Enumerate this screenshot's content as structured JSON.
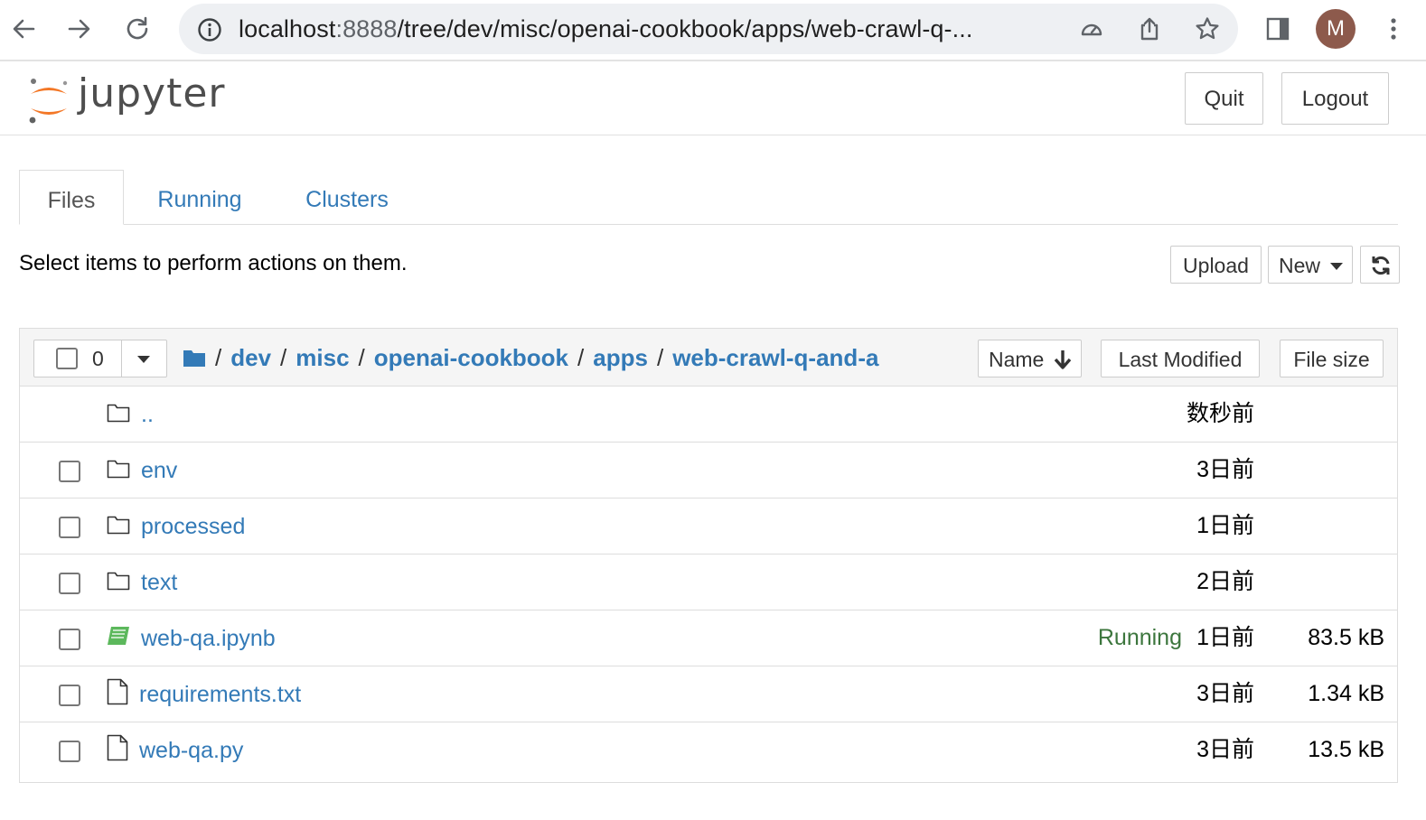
{
  "browser": {
    "url_host": "localhost",
    "url_port": ":8888",
    "url_path": "/tree/dev/misc/openai-cookbook/apps/web-crawl-q-...",
    "avatar_letter": "M"
  },
  "header": {
    "logo_text": "jupyter",
    "quit_label": "Quit",
    "logout_label": "Logout"
  },
  "tabs": [
    {
      "label": "Files"
    },
    {
      "label": "Running"
    },
    {
      "label": "Clusters"
    }
  ],
  "toolbar": {
    "hint": "Select items to perform actions on them.",
    "upload_label": "Upload",
    "new_label": "New"
  },
  "list": {
    "selected_count": "0",
    "breadcrumbs": [
      "dev",
      "misc",
      "openai-cookbook",
      "apps",
      "web-crawl-q-and-a"
    ],
    "sort_name_label": "Name",
    "sort_modified_label": "Last Modified",
    "sort_size_label": "File size",
    "rows": [
      {
        "name": "..",
        "type": "folder",
        "status": "",
        "modified": "数秒前",
        "size": ""
      },
      {
        "name": "env",
        "type": "folder",
        "status": "",
        "modified": "3日前",
        "size": ""
      },
      {
        "name": "processed",
        "type": "folder",
        "status": "",
        "modified": "1日前",
        "size": ""
      },
      {
        "name": "text",
        "type": "folder",
        "status": "",
        "modified": "2日前",
        "size": ""
      },
      {
        "name": "web-qa.ipynb",
        "type": "notebook",
        "status": "Running",
        "modified": "1日前",
        "size": "83.5 kB"
      },
      {
        "name": "requirements.txt",
        "type": "file",
        "status": "",
        "modified": "3日前",
        "size": "1.34 kB"
      },
      {
        "name": "web-qa.py",
        "type": "file",
        "status": "",
        "modified": "3日前",
        "size": "13.5 kB"
      }
    ]
  },
  "colors": {
    "link": "#337ab7",
    "running": "#3c763d",
    "logo_orange": "#f37726",
    "notebook_green": "#5cb85c"
  }
}
